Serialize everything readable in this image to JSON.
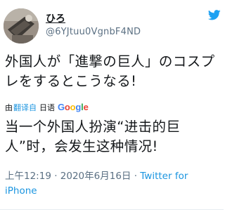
{
  "user": {
    "display_name": "ひろ",
    "handle": "@6YJtuu0VgnbF4ND"
  },
  "tweet": {
    "text": "外国人が「進撃の巨人」のコスプレをするとこうなる!"
  },
  "translation": {
    "by_label": "由",
    "translate_link": "翻译自",
    "source_language": "日语",
    "engine_letters": [
      "G",
      "o",
      "o",
      "g",
      "l",
      "e"
    ],
    "engine_colors": [
      "#4285F4",
      "#EA4335",
      "#FBBC05",
      "#4285F4",
      "#34A853",
      "#EA4335"
    ],
    "text": "当一个外国人扮演“进击的巨人”时，会发生这种情况!"
  },
  "meta": {
    "time": "上午12:19 · 2020年6月16日 · ",
    "source": "Twitter for iPhone"
  },
  "colors": {
    "link": "#1b95e0",
    "muted": "#5b7083",
    "text": "#14171a",
    "twitter_blue": "#1da1f2"
  },
  "icons": {
    "brand": "twitter-bird-icon",
    "avatar": "avatar-photo"
  }
}
